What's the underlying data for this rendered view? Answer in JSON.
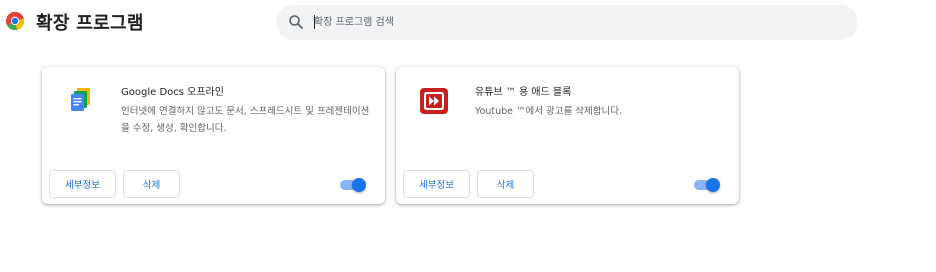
{
  "header": {
    "title": "확장 프로그램",
    "logo_icon": "chrome-logo-icon"
  },
  "search": {
    "placeholder": "확장 프로그램 검색",
    "icon": "search-icon"
  },
  "extensions": [
    {
      "name": "Google Docs 오프라인",
      "description": "인터넷에 연결하지 않고도 문서, 스프레드시트 및 프레젠테이션을 수정, 생성, 확인합니다.",
      "icon": "google-docs-icon",
      "details_label": "세부정보",
      "remove_label": "삭제",
      "enabled": true
    },
    {
      "name": "유튜브 ™ 용 애드 블록",
      "description": "Youtube ™에서 광고를 삭제합니다.",
      "icon": "youtube-adblock-icon",
      "details_label": "세부정보",
      "remove_label": "삭제",
      "enabled": true
    }
  ],
  "colors": {
    "accent": "#1a73e8",
    "toggle_track": "#8ab4f8",
    "search_bg": "#f1f3f4",
    "adblock_red": "#c5221f"
  }
}
